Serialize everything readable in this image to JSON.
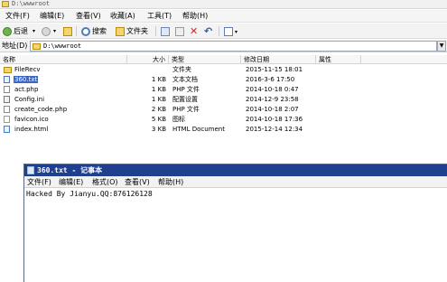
{
  "explorer": {
    "title": "D:\\wwwroot",
    "menu": [
      "文件(F)",
      "编辑(E)",
      "查看(V)",
      "收藏(A)",
      "工具(T)",
      "帮助(H)"
    ],
    "toolbar": {
      "back_label": "后退",
      "search_label": "搜索",
      "folders_label": "文件夹"
    },
    "address": {
      "label": "地址(D)",
      "value": "D:\\wwwroot"
    },
    "columns": {
      "name": "名称",
      "size": "大小",
      "type": "类型",
      "modified": "修改日期",
      "attributes": "属性"
    },
    "files": [
      {
        "name": "FileRecv",
        "size": "",
        "type": "文件夹",
        "modified": "2015-11-15 18:01",
        "icon": "folder-icon"
      },
      {
        "name": "360.txt",
        "size": "1 KB",
        "type": "文本文档",
        "modified": "2016-3-6 17:50",
        "icon": "text-file-icon"
      },
      {
        "name": "act.php",
        "size": "1 KB",
        "type": "PHP 文件",
        "modified": "2014-10-18 0:47",
        "icon": "php-file-icon"
      },
      {
        "name": "Config.ini",
        "size": "1 KB",
        "type": "配置设置",
        "modified": "2014-12-9 23:58",
        "icon": "ini-file-icon"
      },
      {
        "name": "create_code.php",
        "size": "2 KB",
        "type": "PHP 文件",
        "modified": "2014-10-18 2:07",
        "icon": "php-file-icon"
      },
      {
        "name": "favicon.ico",
        "size": "5 KB",
        "type": "图标",
        "modified": "2014-10-18 17:36",
        "icon": "ico-file-icon"
      },
      {
        "name": "index.html",
        "size": "3 KB",
        "type": "HTML Document",
        "modified": "2015-12-14 12:34",
        "icon": "html-file-icon"
      }
    ]
  },
  "notepad": {
    "title": "360.txt - 记事本",
    "menu": [
      "文件(F)",
      "编辑(E)",
      "格式(O)",
      "查看(V)",
      "帮助(H)"
    ],
    "content": "Hacked By Jianyu.QQ:876126128"
  },
  "colors": {
    "selection": "#3a66c4",
    "notepad_titlebar": "#1f3f8f"
  }
}
